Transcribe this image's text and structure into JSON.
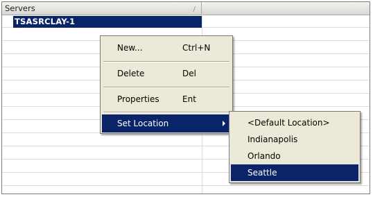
{
  "table": {
    "columns": [
      {
        "label": "Servers"
      },
      {
        "label": ""
      }
    ],
    "rows": [
      {
        "server": "TSASRCLAY-1",
        "selected": true
      }
    ]
  },
  "context_menu": {
    "items": [
      {
        "label": "New...",
        "shortcut": "Ctrl+N"
      },
      {
        "label": "Delete",
        "shortcut": "Del"
      },
      {
        "label": "Properties",
        "shortcut": "Ent"
      },
      {
        "label": "Set Location",
        "shortcut": "",
        "has_submenu": true,
        "highlighted": true
      }
    ]
  },
  "location_submenu": {
    "items": [
      {
        "label": "<Default Location>"
      },
      {
        "label": "Indianapolis"
      },
      {
        "label": "Orlando"
      },
      {
        "label": "Seattle",
        "highlighted": true
      }
    ]
  },
  "colors": {
    "selection": "#0a246a",
    "menu_background": "#ece9d8"
  }
}
